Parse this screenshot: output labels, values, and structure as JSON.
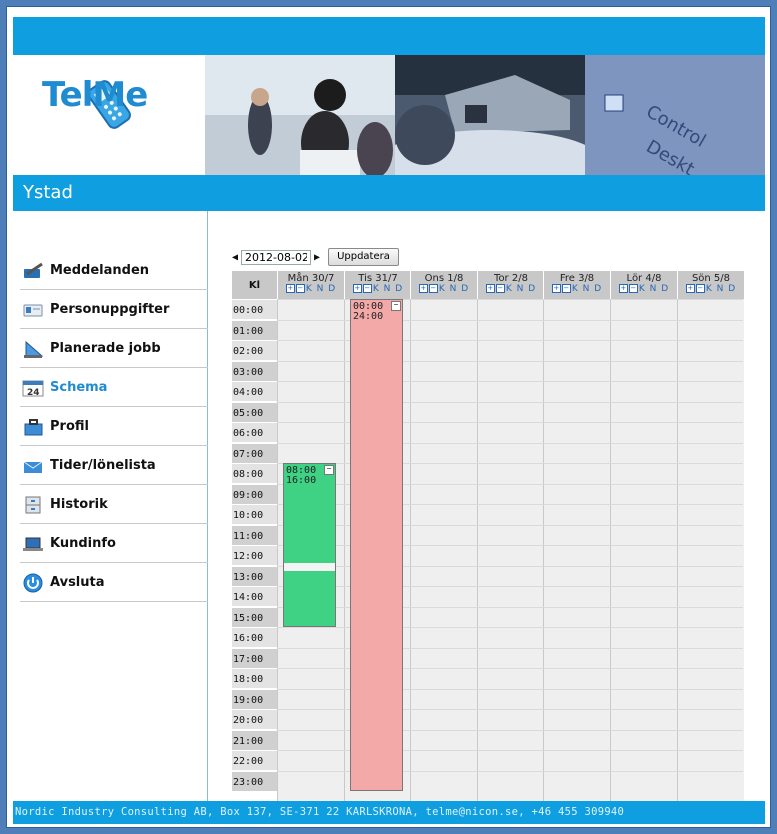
{
  "brand": {
    "name": "TelMe",
    "accent": "#0f9ee0",
    "logo_blue": "#1f8bd0"
  },
  "location": "Ystad",
  "nav": [
    {
      "label": "Meddelanden",
      "icon": "message-pen-icon",
      "active": false
    },
    {
      "label": "Personuppgifter",
      "icon": "id-card-icon",
      "active": false
    },
    {
      "label": "Planerade jobb",
      "icon": "ruler-triangle-icon",
      "active": false
    },
    {
      "label": "Schema",
      "icon": "calendar-24-icon",
      "active": true
    },
    {
      "label": "Profil",
      "icon": "briefcase-icon",
      "active": false
    },
    {
      "label": "Tider/lönelista",
      "icon": "envelope-icon",
      "active": false
    },
    {
      "label": "Historik",
      "icon": "file-cabinet-icon",
      "active": false
    },
    {
      "label": "Kundinfo",
      "icon": "laptop-icon",
      "active": false
    },
    {
      "label": "Avsluta",
      "icon": "power-icon",
      "active": false
    }
  ],
  "schedule": {
    "date": "2012-08-02",
    "update_button": "Uppdatera",
    "time_header": "Kl",
    "day_controls": "K N D",
    "days": [
      "Mån 30/7",
      "Tis 31/7",
      "Ons 1/8",
      "Tor 2/8",
      "Fre 3/8",
      "Lör 4/8",
      "Sön 5/8"
    ],
    "hours": [
      "00:00",
      "01:00",
      "02:00",
      "03:00",
      "04:00",
      "05:00",
      "06:00",
      "07:00",
      "08:00",
      "09:00",
      "10:00",
      "11:00",
      "12:00",
      "13:00",
      "14:00",
      "15:00",
      "16:00",
      "17:00",
      "18:00",
      "19:00",
      "20:00",
      "21:00",
      "22:00",
      "23:00"
    ],
    "events": [
      {
        "day": 0,
        "start": "08:00",
        "end": "16:00",
        "color": "#3fd184"
      },
      {
        "day": 1,
        "start": "00:00",
        "end": "24:00",
        "color": "#f4a9a9"
      }
    ]
  },
  "footer": "Nordic Industry Consulting AB, Box 137, SE-371 22  KARLSKRONA, telme@nicon.se, +46 455 309940"
}
